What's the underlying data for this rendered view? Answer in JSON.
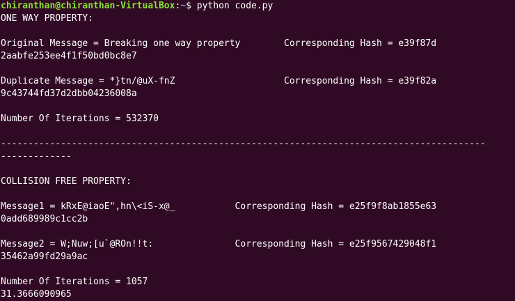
{
  "terminal": {
    "prompt": {
      "user_host": "chiranthan@chiranthan-VirtualBox",
      "colon": ":",
      "path": "~",
      "symbol": "$ ",
      "command": "python code.py"
    },
    "colors": {
      "background": "#300a24",
      "text": "#ffffff",
      "user_host": "#8ae234",
      "path": "#729fcf"
    },
    "lines": [
      "ONE WAY PROPERTY:",
      "",
      "Original Message = Breaking one way property        Corresponding Hash = e39f87d",
      "2aabfe253ee4f1f50bd0bc8e7",
      "",
      "Duplicate Message = *}tn/@uX-fnZ                    Corresponding Hash = e39f82a",
      "9c43744fd37d2dbb04236008a",
      "",
      "Number Of Iterations = 532370",
      "",
      "-----------------------------------------------------------------------------------------",
      "-------------",
      "",
      "COLLISION FREE PROPERTY:",
      "",
      "Message1 = kRxE@iaoE\",hn\\<iS-x@_           Corresponding Hash = e25f9f8ab1855e63",
      "0add689989c1cc2b",
      "",
      "Message2 = W;Nuw;[u`@ROn!!t:               Corresponding Hash = e25f9567429048f1",
      "35462a99fd29a9ac",
      "",
      "Number Of Iterations = 1057",
      "31.3666090965"
    ]
  }
}
